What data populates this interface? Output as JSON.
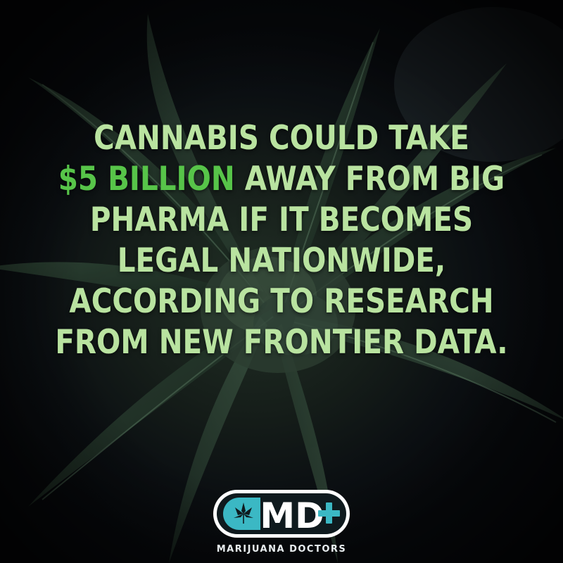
{
  "headline": {
    "line1": "CANNABIS COULD TAKE",
    "line2_highlight": "$5 BILLION",
    "line2_rest": " AWAY FROM BIG",
    "line3": "PHARMA IF IT BECOMES",
    "line4": "LEGAL NATIONWIDE,",
    "line5": "ACCORDING TO RESEARCH",
    "line6": "FROM NEW FRONTIER DATA."
  },
  "logo": {
    "letters": "MD",
    "caption": "MARIJUANA DOCTORS",
    "icon": "cannabis-leaf-icon"
  },
  "colors": {
    "text": "#b9e3a0",
    "highlight": "#57c449",
    "logo_teal": "#3bb8c4",
    "logo_white": "#ffffff",
    "background": "#0a0d12"
  }
}
